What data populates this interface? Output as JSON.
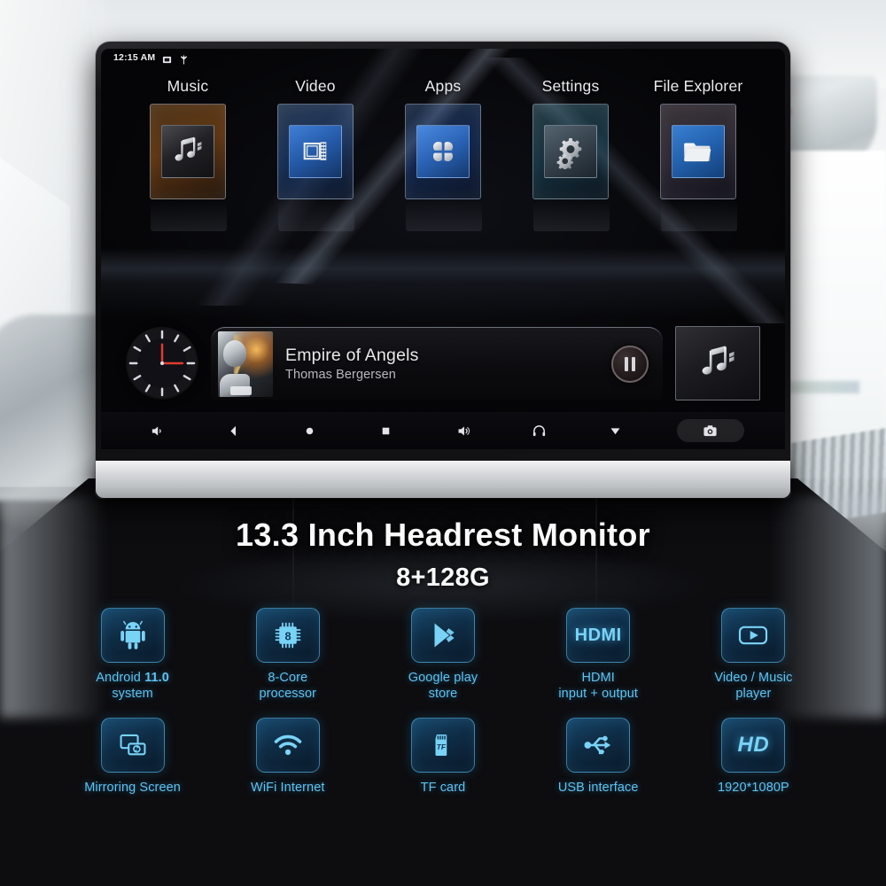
{
  "device": {
    "status_bar": {
      "time": "12:15 AM",
      "icons": [
        "screenshot-icon",
        "location-icon"
      ]
    },
    "home_menu": [
      {
        "label": "Music",
        "icon": "music-note-icon",
        "theme": "music"
      },
      {
        "label": "Video",
        "icon": "film-strip-icon",
        "theme": "video"
      },
      {
        "label": "Apps",
        "icon": "apps-grid-icon",
        "theme": "apps"
      },
      {
        "label": "Settings",
        "icon": "gears-icon",
        "theme": "settings"
      },
      {
        "label": "File Explorer",
        "icon": "folder-icon",
        "theme": "files"
      }
    ],
    "player": {
      "clock_widget": "analog-clock-widget",
      "clock_time": "12:15",
      "track_title": "Empire of Angels",
      "track_artist": "Thomas Bergersen",
      "transport_state": "pause-button",
      "album_art": "album-art-thumbnail",
      "side_tile_icon": "music-note-icon"
    },
    "nav_bar": [
      {
        "name": "volume-down-icon"
      },
      {
        "name": "back-icon"
      },
      {
        "name": "home-icon"
      },
      {
        "name": "recents-icon"
      },
      {
        "name": "volume-up-icon"
      },
      {
        "name": "headphones-icon"
      },
      {
        "name": "collapse-down-icon"
      },
      {
        "name": "screenshot-camera-button"
      }
    ]
  },
  "promo": {
    "title": "13.3 Inch Headrest Monitor",
    "subtitle": "8+128G"
  },
  "features": [
    {
      "icon": "android-robot-icon",
      "label_html": "Android <b>11.0</b><br>system",
      "label": "Android 11.0 system"
    },
    {
      "icon": "cpu-chip-icon",
      "label_html": "8-Core<br>processor",
      "label": "8-Core processor",
      "badge": "8"
    },
    {
      "icon": "google-play-icon",
      "label_html": "Google play<br>store",
      "label": "Google play store"
    },
    {
      "icon": "hdmi-text-icon",
      "label_html": "HDMI<br>input + output",
      "label": "HDMI input + output",
      "badge": "HDMI"
    },
    {
      "icon": "video-player-icon",
      "label_html": "Video / Music<br>player",
      "label": "Video / Music player"
    },
    {
      "icon": "screen-mirroring-icon",
      "label_html": "Mirroring Screen",
      "label": "Mirroring Screen"
    },
    {
      "icon": "wifi-icon",
      "label_html": "WiFi Internet",
      "label": "WiFi Internet"
    },
    {
      "icon": "tf-card-icon",
      "label_html": "TF card",
      "label": "TF card",
      "badge": "TF"
    },
    {
      "icon": "usb-icon",
      "label_html": "USB interface",
      "label": "USB interface"
    },
    {
      "icon": "hd-text-icon",
      "label_html": "1920*1080P",
      "label": "1920*1080P",
      "badge": "HD"
    }
  ],
  "colors": {
    "accent_cyan": "#5ec3f2",
    "icon_glow": "#79d3f7",
    "screen_black": "#050507",
    "bezel_silver": "#d6d8da",
    "music_tile_orange": "#d88a2e",
    "video_tile_blue": "#2459a8"
  }
}
